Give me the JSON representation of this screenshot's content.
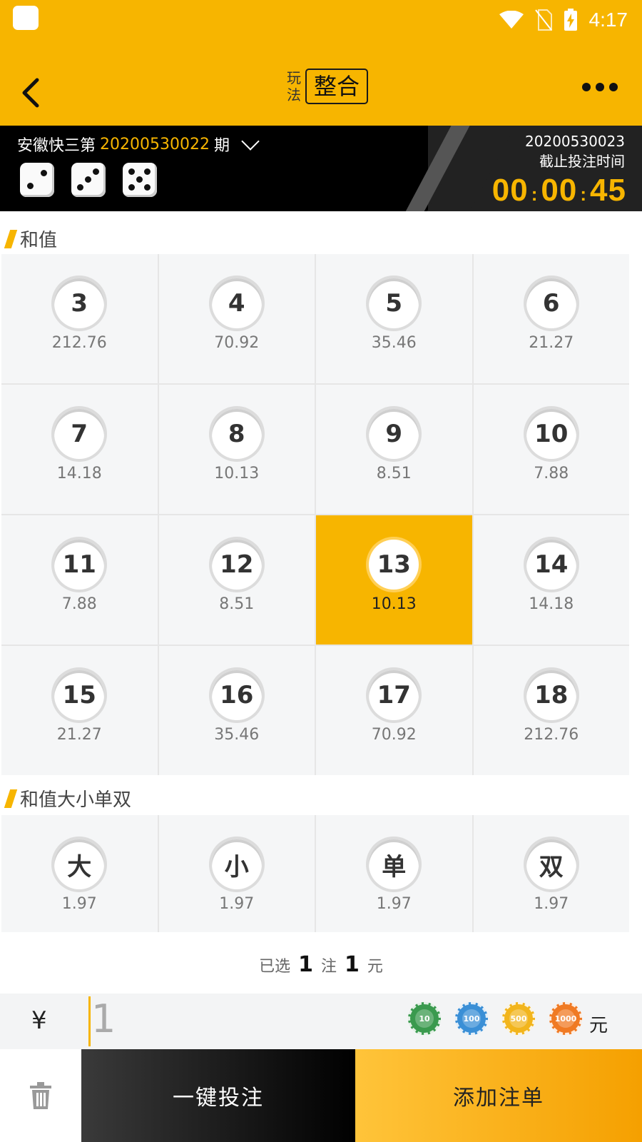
{
  "status_bar": {
    "time": "4:17"
  },
  "header": {
    "play_label": "玩法",
    "play_mode": "整合"
  },
  "issue": {
    "lottery_name": "安徽快三第",
    "issue_number": "20200530022",
    "issue_suffix": "期",
    "next_issue": "20200530023",
    "deadline_label": "截止投注时间",
    "countdown": {
      "h": "00",
      "m": "00",
      "s": "45"
    },
    "dice": [
      2,
      3,
      5
    ]
  },
  "sections": {
    "sum_title": "和值",
    "sum_items": [
      {
        "num": "3",
        "odds": "212.76"
      },
      {
        "num": "4",
        "odds": "70.92"
      },
      {
        "num": "5",
        "odds": "35.46"
      },
      {
        "num": "6",
        "odds": "21.27"
      },
      {
        "num": "7",
        "odds": "14.18"
      },
      {
        "num": "8",
        "odds": "10.13"
      },
      {
        "num": "9",
        "odds": "8.51"
      },
      {
        "num": "10",
        "odds": "7.88"
      },
      {
        "num": "11",
        "odds": "7.88"
      },
      {
        "num": "12",
        "odds": "8.51"
      },
      {
        "num": "13",
        "odds": "10.13",
        "selected": true
      },
      {
        "num": "14",
        "odds": "14.18"
      },
      {
        "num": "15",
        "odds": "21.27"
      },
      {
        "num": "16",
        "odds": "35.46"
      },
      {
        "num": "17",
        "odds": "70.92"
      },
      {
        "num": "18",
        "odds": "212.76"
      }
    ],
    "bsoe_title": "和值大小单双",
    "bsoe_items": [
      {
        "num": "大",
        "odds": "1.97"
      },
      {
        "num": "小",
        "odds": "1.97"
      },
      {
        "num": "单",
        "odds": "1.97"
      },
      {
        "num": "双",
        "odds": "1.97"
      }
    ]
  },
  "summary": {
    "prefix": "已选",
    "bets": "1",
    "bets_unit": "注",
    "amount": "1",
    "amount_unit": "元"
  },
  "amount_bar": {
    "currency": "¥",
    "value": "1",
    "chips": [
      {
        "label": "10",
        "color": "#3a9a4e"
      },
      {
        "label": "100",
        "color": "#3a8fd6"
      },
      {
        "label": "500",
        "color": "#f2b51c"
      },
      {
        "label": "1000",
        "color": "#f07a23"
      }
    ],
    "unit": "元"
  },
  "actions": {
    "quick_bet": "一键投注",
    "add_order": "添加注单"
  }
}
